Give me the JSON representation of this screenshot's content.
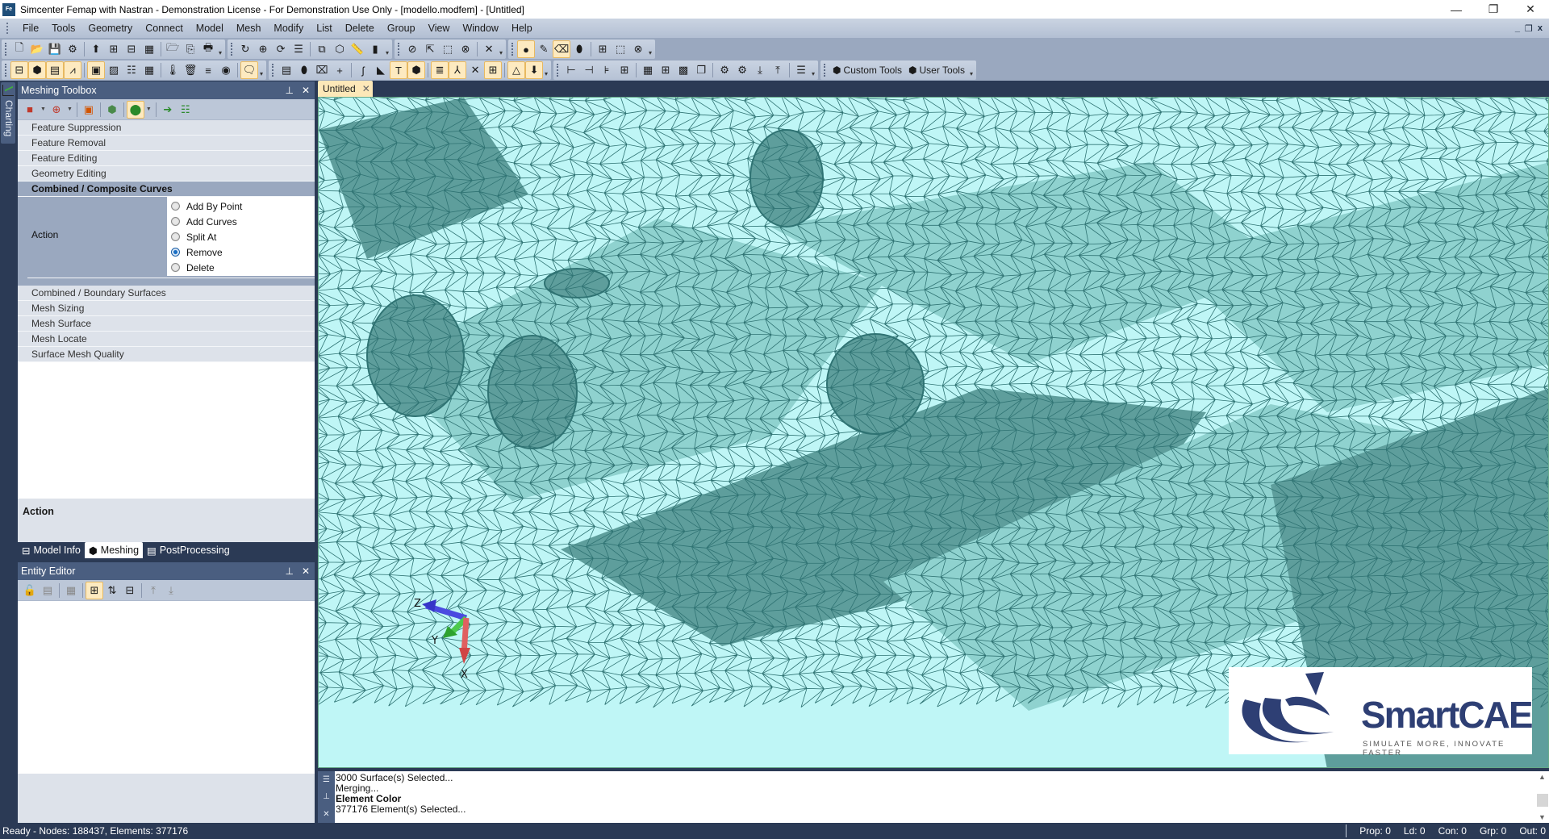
{
  "window": {
    "app_icon_label": "Fe",
    "title": "Simcenter Femap with Nastran - Demonstration License - For Demonstration Use Only - [modello.modfem] - [Untitled]",
    "controls": {
      "minimize": "—",
      "restore": "❐",
      "close": "✕"
    }
  },
  "menu": {
    "items": [
      "File",
      "Tools",
      "Geometry",
      "Connect",
      "Model",
      "Mesh",
      "Modify",
      "List",
      "Delete",
      "Group",
      "View",
      "Window",
      "Help"
    ],
    "mdi_controls": {
      "minimize": "_",
      "restore": "❐",
      "close": "x"
    }
  },
  "toolbars": {
    "row1": [
      {
        "icon": "new-file-icon",
        "glyph": "🗋"
      },
      {
        "icon": "open-folder-icon",
        "glyph": "📂"
      },
      {
        "icon": "save-icon",
        "glyph": "💾"
      },
      {
        "icon": "rebuild-icon",
        "glyph": "⚙"
      },
      {
        "icon": "import-geometry-icon",
        "glyph": "⬆"
      },
      {
        "icon": "import-analysis-icon",
        "glyph": "⊞"
      },
      {
        "icon": "export-analysis-icon",
        "glyph": "⊟"
      },
      {
        "icon": "import-results-icon",
        "glyph": "▦"
      },
      {
        "icon": "program-file-icon",
        "glyph": "🗁"
      },
      {
        "icon": "copy-picture-icon",
        "glyph": "⎘"
      },
      {
        "icon": "print-icon",
        "glyph": "🖶"
      },
      {
        "icon": "regenerate-icon",
        "glyph": "↻"
      },
      {
        "icon": "zoom-window-icon",
        "glyph": "⊕"
      },
      {
        "icon": "rotate-view-icon",
        "glyph": "⟳"
      },
      {
        "icon": "view-options-icon",
        "glyph": "☰"
      },
      {
        "icon": "view-select-icon",
        "glyph": "⧉"
      },
      {
        "icon": "view-style-icon",
        "glyph": "⬡"
      },
      {
        "icon": "measure-icon",
        "glyph": "📏"
      },
      {
        "icon": "post-data-icon",
        "glyph": "▮"
      },
      {
        "icon": "show-entities-icon",
        "glyph": "⊘"
      },
      {
        "icon": "select-pick-icon",
        "glyph": "⇱"
      },
      {
        "icon": "select-box-icon",
        "glyph": "⬚"
      },
      {
        "icon": "select-none-icon",
        "glyph": "⊗"
      },
      {
        "icon": "delete-entity-icon",
        "glyph": "✕"
      },
      {
        "icon": "color-point-icon",
        "glyph": "●"
      },
      {
        "icon": "paint-icon",
        "glyph": "✎"
      },
      {
        "icon": "eraser-icon",
        "glyph": "⌫"
      },
      {
        "icon": "color-solid-icon",
        "glyph": "⬮"
      },
      {
        "icon": "color-surface-icon",
        "glyph": "⊞"
      },
      {
        "icon": "color-box-icon",
        "glyph": "⬚"
      },
      {
        "icon": "reset-color-icon",
        "glyph": "⊗"
      }
    ],
    "row2": [
      {
        "icon": "model-info-icon",
        "glyph": "⊟"
      },
      {
        "icon": "meshing-toolbox-icon",
        "glyph": "⬢"
      },
      {
        "icon": "postprocessing-toolbox-icon",
        "glyph": "▤"
      },
      {
        "icon": "charting-icon",
        "glyph": "⩘"
      },
      {
        "icon": "data-surface-icon",
        "glyph": "▣"
      },
      {
        "icon": "contour-icon",
        "glyph": "▨"
      },
      {
        "icon": "data-table-icon",
        "glyph": "☷"
      },
      {
        "icon": "spreadsheet-icon",
        "glyph": "▦"
      },
      {
        "icon": "temperature-icon",
        "glyph": "🌡"
      },
      {
        "icon": "bin-icon",
        "glyph": "🗑"
      },
      {
        "icon": "layers-icon",
        "glyph": "≡"
      },
      {
        "icon": "record-icon",
        "glyph": "◉"
      },
      {
        "icon": "messages-icon",
        "glyph": "🗨"
      },
      {
        "icon": "mesh-control-icon",
        "glyph": "▤"
      },
      {
        "icon": "mesh-solid-icon",
        "glyph": "⬮"
      },
      {
        "icon": "mesh-delete-icon",
        "glyph": "⌧"
      },
      {
        "icon": "mesh-point-icon",
        "glyph": "+"
      },
      {
        "icon": "mesh-curve-icon",
        "glyph": "ʃ"
      },
      {
        "icon": "mesh-surface-icon",
        "glyph": "◣"
      },
      {
        "icon": "mesh-text-icon",
        "glyph": "T"
      },
      {
        "icon": "mesh-volume-icon",
        "glyph": "⬢"
      },
      {
        "icon": "mesh-spring-icon",
        "glyph": "≣"
      },
      {
        "icon": "mesh-csys-icon",
        "glyph": "⅄"
      },
      {
        "icon": "mesh-cross-icon",
        "glyph": "✕"
      },
      {
        "icon": "mesh-grid-icon",
        "glyph": "⊞"
      },
      {
        "icon": "mesh-triangle-icon",
        "glyph": "△"
      },
      {
        "icon": "mesh-load-icon",
        "glyph": "⬇"
      },
      {
        "icon": "align-icon",
        "glyph": "⊢"
      },
      {
        "icon": "align2-icon",
        "glyph": "⊣"
      },
      {
        "icon": "align3-icon",
        "glyph": "⊧"
      },
      {
        "icon": "window-tile-icon",
        "glyph": "⊞"
      },
      {
        "icon": "window-tile2-icon",
        "glyph": "▦"
      },
      {
        "icon": "window-tile3-icon",
        "glyph": "⊞"
      },
      {
        "icon": "window-tile4-icon",
        "glyph": "▩"
      },
      {
        "icon": "cascade-icon",
        "glyph": "❐"
      },
      {
        "icon": "view-save-icon",
        "glyph": "⚙"
      },
      {
        "icon": "view-load-icon",
        "glyph": "⚙"
      },
      {
        "icon": "download-icon",
        "glyph": "⤓"
      },
      {
        "icon": "upload-icon",
        "glyph": "⤒"
      },
      {
        "icon": "notes-icon",
        "glyph": "☰"
      }
    ],
    "custom_tools": "Custom Tools",
    "user_tools": "User Tools"
  },
  "side_strip": {
    "charting": "Charting"
  },
  "meshing_toolbox": {
    "title": "Meshing Toolbox",
    "pin": "⊥",
    "close": "✕",
    "sections_before": [
      "Feature Suppression",
      "Feature Removal",
      "Feature Editing",
      "Geometry Editing"
    ],
    "expanded_section": {
      "title": "Combined / Composite Curves",
      "field_label": "Action",
      "options": [
        {
          "label": "Add By Point",
          "checked": false
        },
        {
          "label": "Add Curves",
          "checked": false
        },
        {
          "label": "Split At",
          "checked": false
        },
        {
          "label": "Remove",
          "checked": true
        },
        {
          "label": "Delete",
          "checked": false
        }
      ]
    },
    "sections_after": [
      "Combined / Boundary Surfaces",
      "Mesh Sizing",
      "Mesh Surface",
      "Mesh Locate",
      "Surface Mesh Quality"
    ],
    "description_title": "Action"
  },
  "panel_tabs": [
    {
      "label": "Model Info",
      "active": false
    },
    {
      "label": "Meshing",
      "active": true
    },
    {
      "label": "PostProcessing",
      "active": false
    }
  ],
  "entity_editor": {
    "title": "Entity Editor",
    "pin": "⊥",
    "close": "✕"
  },
  "document": {
    "tab_label": "Untitled",
    "tab_close": "✕"
  },
  "triad": {
    "x": "X",
    "y": "Y",
    "z": "Z"
  },
  "logo": {
    "name": "SmartCAE",
    "tagline": "SIMULATE MORE, INNOVATE FASTER"
  },
  "messages": {
    "lines": [
      {
        "text": "3000 Surface(s) Selected...",
        "bold": false
      },
      {
        "text": "Merging...",
        "bold": false
      },
      {
        "text": "Element Color",
        "bold": true
      },
      {
        "text": "377176 Element(s) Selected...",
        "bold": false
      }
    ]
  },
  "status": {
    "left": "Ready - Nodes: 188437,  Elements: 377176",
    "right": [
      "Prop: 0",
      "Ld: 0",
      "Con: 0",
      "Grp: 0",
      "Out: 0"
    ]
  },
  "colors": {
    "mesh_fill_light": "#bff6f6",
    "mesh_fill_mid": "#8fd2cf",
    "mesh_fill_dark": "#5e9e9c",
    "mesh_edge": "#2f7373",
    "panel_header": "#4a5e80",
    "frame": "#2b3a55",
    "logo_blue": "#2e3f74"
  }
}
